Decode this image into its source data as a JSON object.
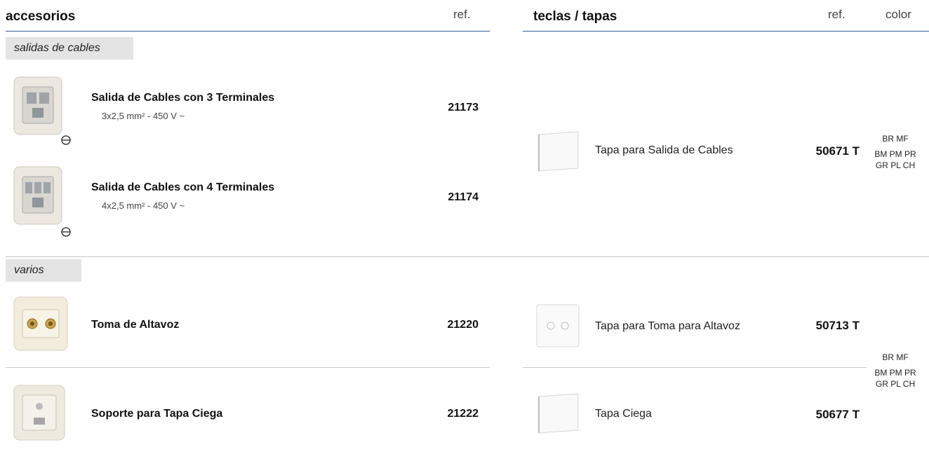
{
  "left": {
    "title": "accesorios",
    "ref_header": "ref.",
    "sections": [
      {
        "label": "salidas de cables"
      },
      {
        "label": "varios"
      }
    ],
    "products": [
      {
        "name": "Salida de Cables con 3 Terminales",
        "spec": "3x2,5 mm² - 450 V ~",
        "ref": "21173"
      },
      {
        "name": "Salida de Cables con 4 Terminales",
        "spec": "4x2,5 mm² - 450 V ~",
        "ref": "21174"
      },
      {
        "name": "Toma de Altavoz",
        "ref": "21220"
      },
      {
        "name": "Soporte para Tapa Ciega",
        "ref": "21222"
      }
    ]
  },
  "right": {
    "title": "teclas / tapas",
    "ref_header": "ref.",
    "color_header": "color",
    "covers": [
      {
        "name": "Tapa para Salida de Cables",
        "ref": "50671 T"
      },
      {
        "name": "Tapa para Toma para Altavoz",
        "ref": "50713 T"
      },
      {
        "name": "Tapa Ciega",
        "ref": "50677 T"
      }
    ],
    "color_groups": [
      {
        "lines": [
          "BR MF",
          "BM PM PR",
          "GR PL CH"
        ]
      },
      {
        "lines": [
          "BR MF",
          "BM PM PR",
          "GR PL CH"
        ]
      }
    ]
  },
  "icons": {
    "screw": "screw-head-icon"
  }
}
